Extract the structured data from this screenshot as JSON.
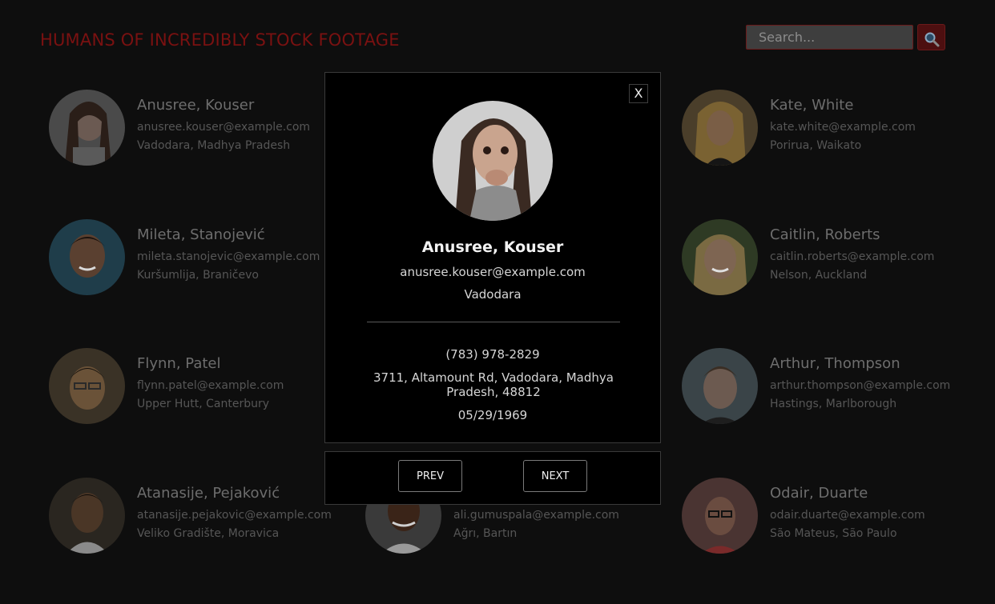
{
  "header": {
    "title": "HUMANS OF INCREDIBLY STOCK FOOTAGE",
    "search_placeholder": "Search...",
    "search_icon": "magnifier-icon"
  },
  "employees": [
    {
      "name": "Anusree, Kouser",
      "email": "anusree.kouser@example.com",
      "location": "Vadodara, Madhya Pradesh"
    },
    {
      "name": "Kate, White",
      "email": "kate.white@example.com",
      "location": "Porirua, Waikato"
    },
    {
      "name": "Mileta, Stanojević",
      "email": "mileta.stanojevic@example.com",
      "location": "Kuršumlija, Braničevo"
    },
    {
      "name": "Caitlin, Roberts",
      "email": "caitlin.roberts@example.com",
      "location": "Nelson, Auckland"
    },
    {
      "name": "Flynn, Patel",
      "email": "flynn.patel@example.com",
      "location": "Upper Hutt, Canterbury"
    },
    {
      "name": "Arthur, Thompson",
      "email": "arthur.thompson@example.com",
      "location": "Hastings, Marlborough"
    },
    {
      "name": "Atanasije, Pejaković",
      "email": "atanasije.pejakovic@example.com",
      "location": "Veliko Gradište, Moravica"
    },
    {
      "name": "",
      "email": "ali.gumuspala@example.com",
      "location": "Ağrı, Bartın"
    },
    {
      "name": "Odair, Duarte",
      "email": "odair.duarte@example.com",
      "location": "São Mateus, São Paulo"
    }
  ],
  "modal": {
    "close_label": "X",
    "name": "Anusree, Kouser",
    "email": "anusree.kouser@example.com",
    "city": "Vadodara",
    "phone": "(783) 978-2829",
    "address": "3711, Altamount Rd, Vadodara, Madhya Pradesh, 48812",
    "birthday": "05/29/1969",
    "prev_label": "PREV",
    "next_label": "NEXT"
  },
  "colors": {
    "background": "#0e0e0e",
    "title_accent": "#7a1111",
    "search_button": "#4d0f10",
    "modal_background": "#000000"
  }
}
